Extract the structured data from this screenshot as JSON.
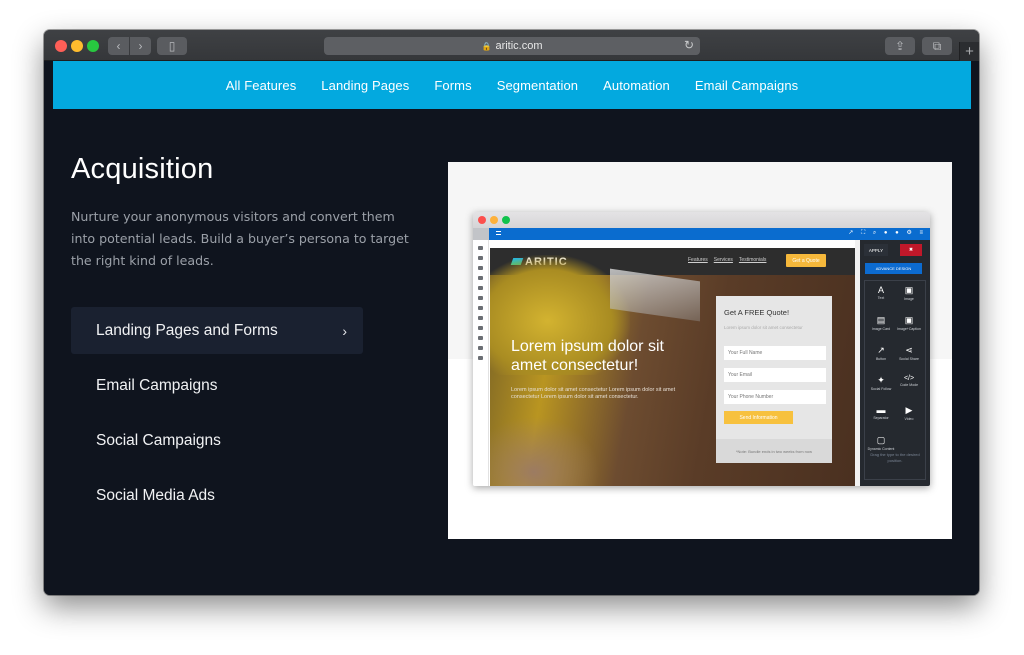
{
  "browser": {
    "url": "aritic.com",
    "buttons": {
      "back": "‹",
      "forward": "›",
      "sidebar": "▯",
      "reload": "↻",
      "share": "⇪",
      "tabs": "⧉",
      "new_tab": "+"
    },
    "lock_icon": "🔒"
  },
  "topnav": {
    "items": [
      "All Features",
      "Landing Pages",
      "Forms",
      "Segmentation",
      "Automation",
      "Email Campaigns"
    ]
  },
  "section": {
    "title": "Acquisition",
    "description": "Nurture your anonymous visitors and convert them into potential leads. Build a buyer’s persona to target the right kind of leads."
  },
  "features": {
    "items": [
      {
        "label": "Landing Pages and Forms",
        "active": true,
        "chevron": "›"
      },
      {
        "label": "Email Campaigns",
        "active": false
      },
      {
        "label": "Social Campaigns",
        "active": false
      },
      {
        "label": "Social Media Ads",
        "active": false
      }
    ]
  },
  "mockup": {
    "brand": "ARITIC",
    "nav_links": [
      "Features",
      "Services",
      "Testimonials"
    ],
    "cta": "Get a Quote",
    "hero_title": "Lorem ipsum dolor sit amet consectetur!",
    "hero_text": "Lorem ipsum dolor sit amet consectetur Lorem ipsum dolor sit amet consectetur Lorem ipsum dolor sit amet consectetur.",
    "form": {
      "title": "Get A FREE Quote!",
      "subtitle": "Lorem ipsum dolor sit amet consectetur",
      "fields": [
        "Your Full Name",
        "Your Email",
        "Your Phone Number"
      ],
      "submit": "Send Information",
      "note": "*Note: Bundle ends in two weeks from now"
    },
    "panel": {
      "apply": "APPLY",
      "close": "✖",
      "advance": "ADVANCE DESIGN",
      "blocks": [
        {
          "icon": "A",
          "label": "Text"
        },
        {
          "icon": "▣",
          "label": "Image"
        },
        {
          "icon": "▤",
          "label": "Image Card"
        },
        {
          "icon": "▣",
          "label": "Image+Caption"
        },
        {
          "icon": "↗",
          "label": "Button"
        },
        {
          "icon": "⋖",
          "label": "Social Share"
        },
        {
          "icon": "✦",
          "label": "Social Follow"
        },
        {
          "icon": "</>",
          "label": "Code Mode"
        },
        {
          "icon": "▬",
          "label": "Separator"
        },
        {
          "icon": "▶",
          "label": "Video"
        },
        {
          "icon": "▢",
          "label": "Dynamic Content"
        }
      ],
      "hint": "Drag the type to the desired position."
    }
  }
}
